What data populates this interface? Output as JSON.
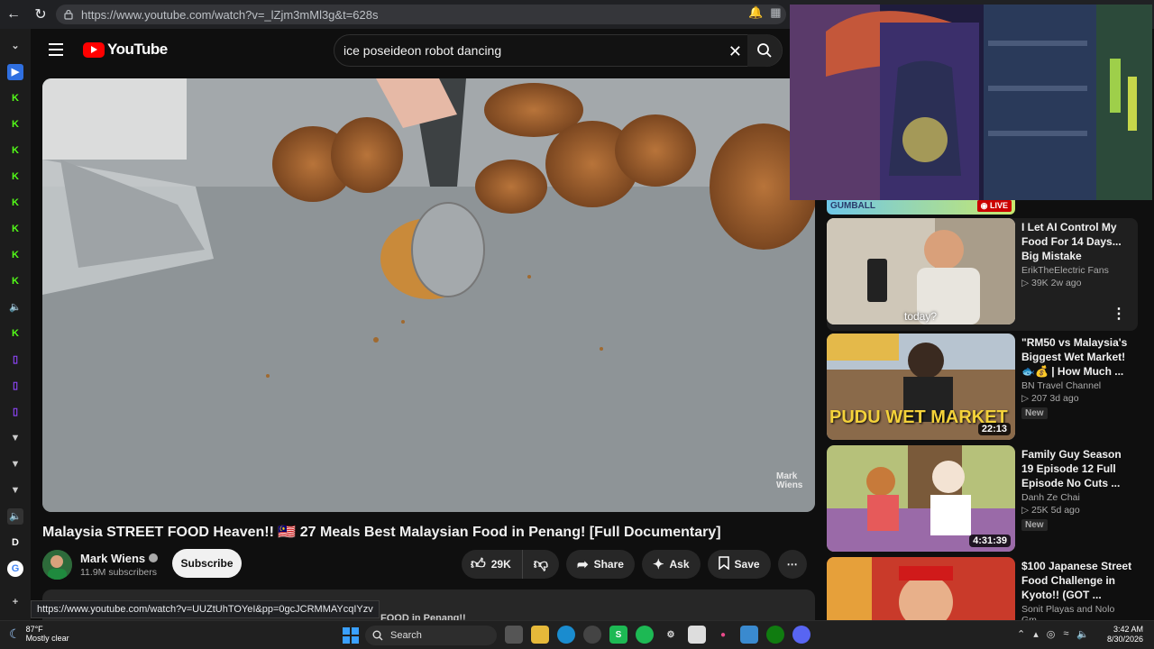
{
  "browser": {
    "url": "https://www.youtube.com/watch?v=_lZjm3mMl3g&t=628s",
    "status_url": "https://www.youtube.com/watch?v=UUZtUhTOYeI&pp=0gcJCRMMAYcqIYzv"
  },
  "youtube": {
    "logo_text": "YouTube",
    "search_value": "ice poseideon robot dancing"
  },
  "video": {
    "title": "Malaysia STREET FOOD Heaven!! 🇲🇾 27 Meals Best Malaysian Food in Penang! [Full Documentary]",
    "watermark": "Mark Wiens",
    "channel": "Mark Wiens",
    "subscribers": "11.9M subscribers",
    "subscribe_label": "Subscribe",
    "likes": "29K",
    "share_label": "Share",
    "ask_label": "Ask",
    "save_label": "Save",
    "desc_peek": "FOOD in Penang!!"
  },
  "stream_overlay": {
    "live_label": "LIVE",
    "banner_text": "GUMBALL"
  },
  "recommendations": [
    {
      "title": "I Let AI Control My Food For 14 Days... Big Mistake",
      "channel": "ErikTheElectric Fans",
      "meta": "39K   2w ago",
      "caption": "today?",
      "duration": "",
      "badge": ""
    },
    {
      "title": "\"RM50 vs Malaysia's Biggest Wet Market! 🐟💰 | How Much ...",
      "channel": "BN Travel Channel",
      "meta": "207   3d ago",
      "caption": "PUDU WET MARKET",
      "duration": "22:13",
      "badge": "New"
    },
    {
      "title": "Family Guy Season 19 Episode 12 Full Episode No Cuts ...",
      "channel": "Danh Ze Chai",
      "meta": "25K   5d ago",
      "caption": "",
      "duration": "4:31:39",
      "badge": "New"
    },
    {
      "title": "$100 Japanese Street Food Challenge in Kyoto!! (GOT ...",
      "channel": "Sonit Playas and Nolo Gm...",
      "meta": "",
      "caption": "",
      "duration": "",
      "badge": ""
    }
  ],
  "taskbar": {
    "temperature": "87°F",
    "weather": "Mostly clear",
    "search_label": "Search",
    "time": "3:42 AM",
    "date": "8/30/2026"
  },
  "colors": {
    "yt_red": "#ff0000",
    "background": "#0f0f0f",
    "pill_bg": "#272727"
  }
}
